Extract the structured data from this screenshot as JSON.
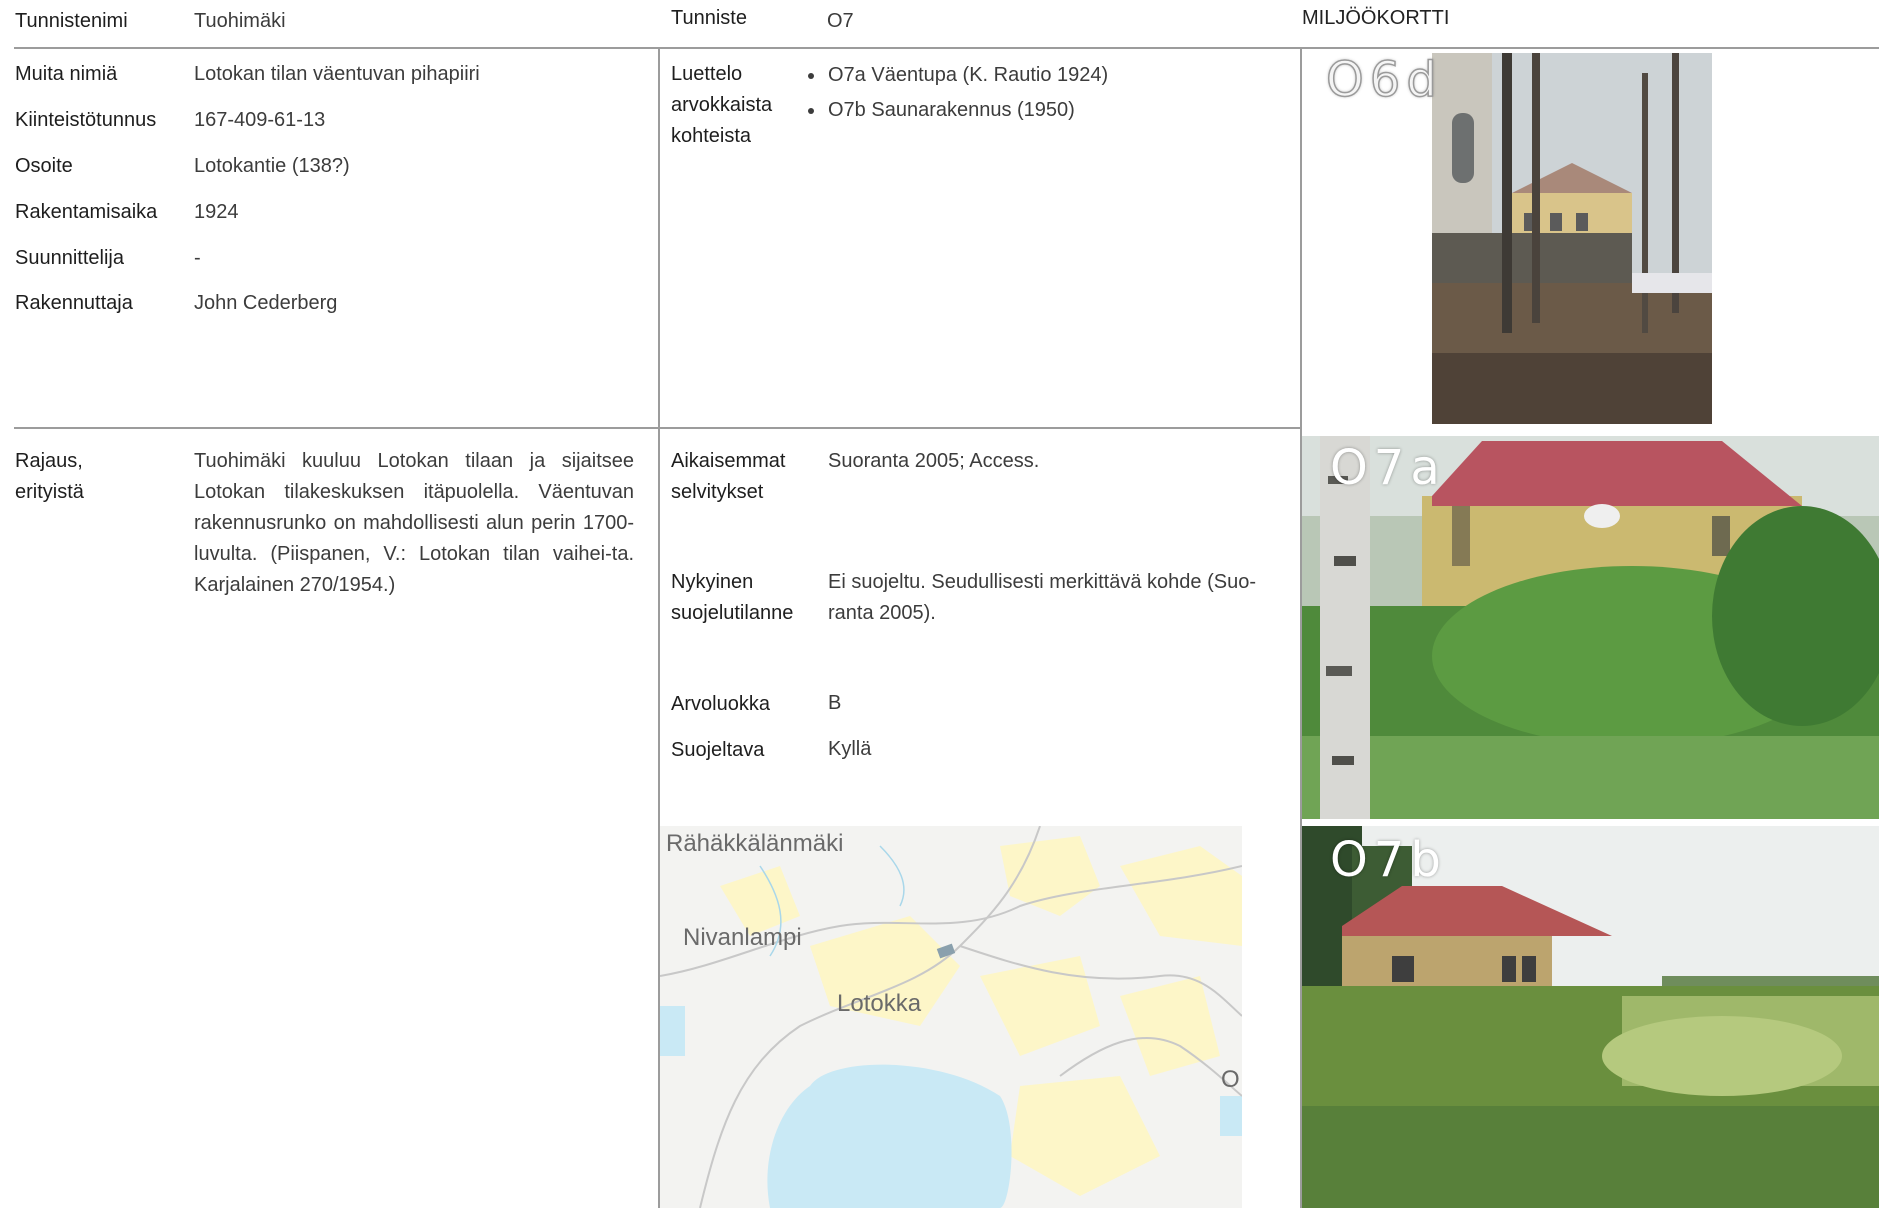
{
  "header": {
    "name_label": "Tunnistenimi",
    "name_value": "Tuohimäki",
    "id_label": "Tunniste",
    "id_value": "O7",
    "card_title": "MILJÖÖKORTTI"
  },
  "info": [
    {
      "label": "Muita nimiä",
      "value": "Lotokan tilan väentuvan pihapiiri"
    },
    {
      "label": "Kiinteistötunnus",
      "value": "167-409-61-13"
    },
    {
      "label": "Osoite",
      "value": "Lotokantie (138?)"
    },
    {
      "label": "Rakentamisaika",
      "value": "1924"
    },
    {
      "label": "Suunnittelija",
      "value": "-"
    },
    {
      "label": "Rakennuttaja",
      "value": "John Cederberg"
    }
  ],
  "list_section": {
    "label_lines": [
      "Luettelo",
      "arvokkaista",
      "kohteista"
    ],
    "items": [
      "O7a Väentupa (K. Rautio 1924)",
      "O7b Saunarakennus (1950)"
    ]
  },
  "boundary": {
    "label_lines": [
      "Rajaus,",
      "erityistä"
    ],
    "text": "Tuohimäki kuuluu Lotokan tilaan ja sijaitsee Lotokan tilakeskuksen itäpuolella. Väentuvan rakennusrunko on mahdollisesti alun perin 1700-luvulta. (Piispanen, V.: Lotokan tilan vaihei-ta. Karjalainen 270/1954.)"
  },
  "previous": {
    "label_lines": [
      "Aikaisemmat",
      "selvitykset"
    ],
    "value": "Suoranta 2005; Access."
  },
  "protection": {
    "label_lines": [
      "Nykyinen",
      "suojelutilanne"
    ],
    "value_lines": [
      "Ei suojeltu. Seudullisesti merkittävä kohde (Suo-",
      "ranta 2005)."
    ]
  },
  "value_class": {
    "label": "Arvoluokka",
    "value": "B"
  },
  "to_protect": {
    "label": "Suojeltava",
    "value": "Kyllä"
  },
  "photos": [
    {
      "label": "O6d",
      "subject": "yard-with-trees-and-yellow-house"
    },
    {
      "label": "O7a",
      "subject": "yellow-gambrel-roof-house-in-greenery"
    },
    {
      "label": "O7b",
      "subject": "sauna-building-by-field"
    }
  ],
  "map": {
    "labels": [
      "Rähäkkälänmäki",
      "Nivanlampi",
      "Lotokka",
      "O"
    ],
    "colors": {
      "field": "#fdf6c8",
      "water": "#c9e9f5",
      "road": "#c8c8c8",
      "background": "#f3f3f1"
    }
  }
}
